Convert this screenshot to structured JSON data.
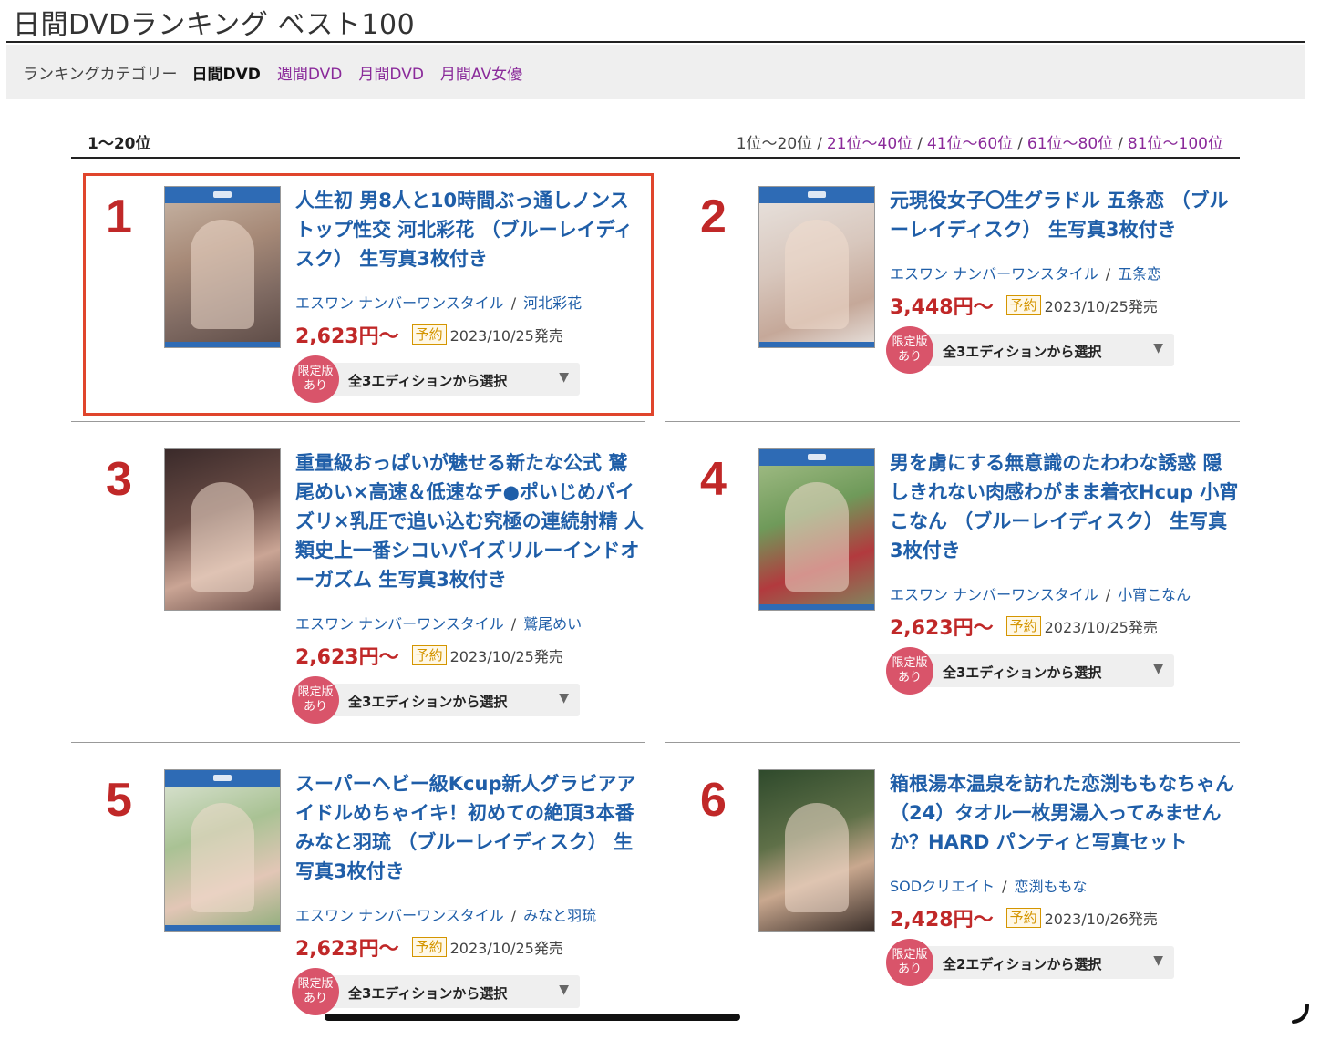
{
  "page": {
    "title": "日間DVDランキング ベスト100"
  },
  "categories": {
    "label": "ランキングカテゴリー",
    "active": "日間DVD",
    "links": [
      "週間DVD",
      "月間DVD",
      "月間AV女優"
    ]
  },
  "range": {
    "current": "1〜20位",
    "current_link": "1位〜20位",
    "separator": "/",
    "links": [
      "21位〜40位",
      "41位〜60位",
      "61位〜80位",
      "81位〜100位"
    ]
  },
  "items": [
    {
      "rank": "1",
      "title": "人生初 男8人と10時間ぶっ通しノンストップ性交 河北彩花 （ブルーレイディスク） 生写真3枚付き",
      "maker": "エスワン ナンバーワンスタイル",
      "actress": "河北彩花",
      "price": "2,623円〜",
      "reserve": "予約",
      "release": "2023/10/25発売",
      "limited_line1": "限定版",
      "limited_line2": "あり",
      "edition": "全3エディションから選択"
    },
    {
      "rank": "2",
      "title": "元現役女子〇生グラドル 五条恋 （ブルーレイディスク） 生写真3枚付き",
      "maker": "エスワン ナンバーワンスタイル",
      "actress": "五条恋",
      "price": "3,448円〜",
      "reserve": "予約",
      "release": "2023/10/25発売",
      "limited_line1": "限定版",
      "limited_line2": "あり",
      "edition": "全3エディションから選択"
    },
    {
      "rank": "3",
      "title": "重量級おっぱいが魅せる新たな公式 鷲尾めい×高速＆低速なチ●ポいじめパイズリ×乳圧で追い込む究極の連続射精 人類史上一番シコいパイズリルーインドオーガズム 生写真3枚付き",
      "maker": "エスワン ナンバーワンスタイル",
      "actress": "鷲尾めい",
      "price": "2,623円〜",
      "reserve": "予約",
      "release": "2023/10/25発売",
      "limited_line1": "限定版",
      "limited_line2": "あり",
      "edition": "全3エディションから選択"
    },
    {
      "rank": "4",
      "title": "男を虜にする無意識のたわわな誘惑 隠しきれない肉感わがまま着衣Hcup 小宵こなん （ブルーレイディスク） 生写真3枚付き",
      "maker": "エスワン ナンバーワンスタイル",
      "actress": "小宵こなん",
      "price": "2,623円〜",
      "reserve": "予約",
      "release": "2023/10/25発売",
      "limited_line1": "限定版",
      "limited_line2": "あり",
      "edition": "全3エディションから選択"
    },
    {
      "rank": "5",
      "title": "スーパーヘビー級Kcup新人グラビアアイドルめちゃイキ！初めての絶頂3本番 みなと羽琉 （ブルーレイディスク） 生写真3枚付き",
      "maker": "エスワン ナンバーワンスタイル",
      "actress": "みなと羽琉",
      "price": "2,623円〜",
      "reserve": "予約",
      "release": "2023/10/25発売",
      "limited_line1": "限定版",
      "limited_line2": "あり",
      "edition": "全3エディションから選択"
    },
    {
      "rank": "6",
      "title": "箱根湯本温泉を訪れた恋渕ももなちゃん（24）タオル一枚男湯入ってみませんか？HARD パンティと写真セット",
      "maker": "SODクリエイト",
      "actress": "恋渕ももな",
      "price": "2,428円〜",
      "reserve": "予約",
      "release": "2023/10/26発売",
      "limited_line1": "限定版",
      "limited_line2": "あり",
      "edition": "全2エディションから選択"
    }
  ]
}
